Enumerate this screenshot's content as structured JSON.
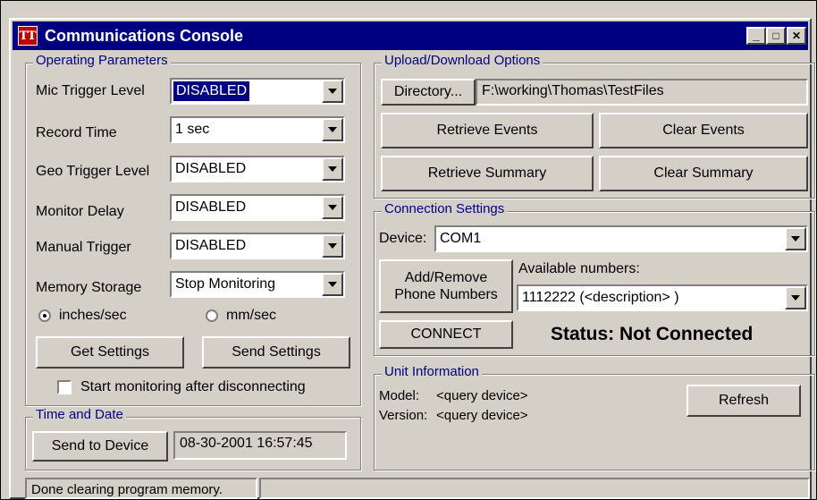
{
  "window": {
    "icon_text": "TT",
    "title": "Communications Console",
    "minimize": "_",
    "maximize": "□",
    "close": "✕"
  },
  "operating": {
    "legend": "Operating Parameters",
    "rows": [
      {
        "label": "Mic Trigger Level",
        "value": "DISABLED"
      },
      {
        "label": "Record Time",
        "value": "1 sec"
      },
      {
        "label": "Geo Trigger Level",
        "value": "DISABLED"
      },
      {
        "label": "Monitor Delay",
        "value": "DISABLED"
      },
      {
        "label": "Manual Trigger",
        "value": "DISABLED"
      },
      {
        "label": "Memory Storage",
        "value": "Stop Monitoring"
      }
    ],
    "radio_inches": "inches/sec",
    "radio_mm": "mm/sec",
    "get_settings": "Get Settings",
    "send_settings": "Send Settings",
    "start_monitoring": "Start monitoring after disconnecting"
  },
  "time_date": {
    "legend": "Time and Date",
    "send_to_device": "Send to Device",
    "datetime": "08-30-2001  16:57:45"
  },
  "upload": {
    "legend": "Upload/Download Options",
    "directory_button": "Directory...",
    "directory_path": "F:\\working\\Thomas\\TestFiles",
    "retrieve_events": "Retrieve Events",
    "clear_events": "Clear Events",
    "retrieve_summary": "Retrieve Summary",
    "clear_summary": "Clear Summary"
  },
  "connection": {
    "legend": "Connection Settings",
    "device_label": "Device:",
    "device_value": "COM1",
    "add_remove_line1": "Add/Remove",
    "add_remove_line2": "Phone Numbers",
    "available_label": "Available numbers:",
    "available_value": "1112222 (<description> )",
    "connect_button": "CONNECT",
    "status": "Status: Not Connected"
  },
  "unit": {
    "legend": "Unit Information",
    "model_label": "Model:",
    "model_value": "<query device>",
    "version_label": "Version:",
    "version_value": "<query device>",
    "refresh_button": "Refresh"
  },
  "statusbar": {
    "message": "Done clearing program memory."
  }
}
